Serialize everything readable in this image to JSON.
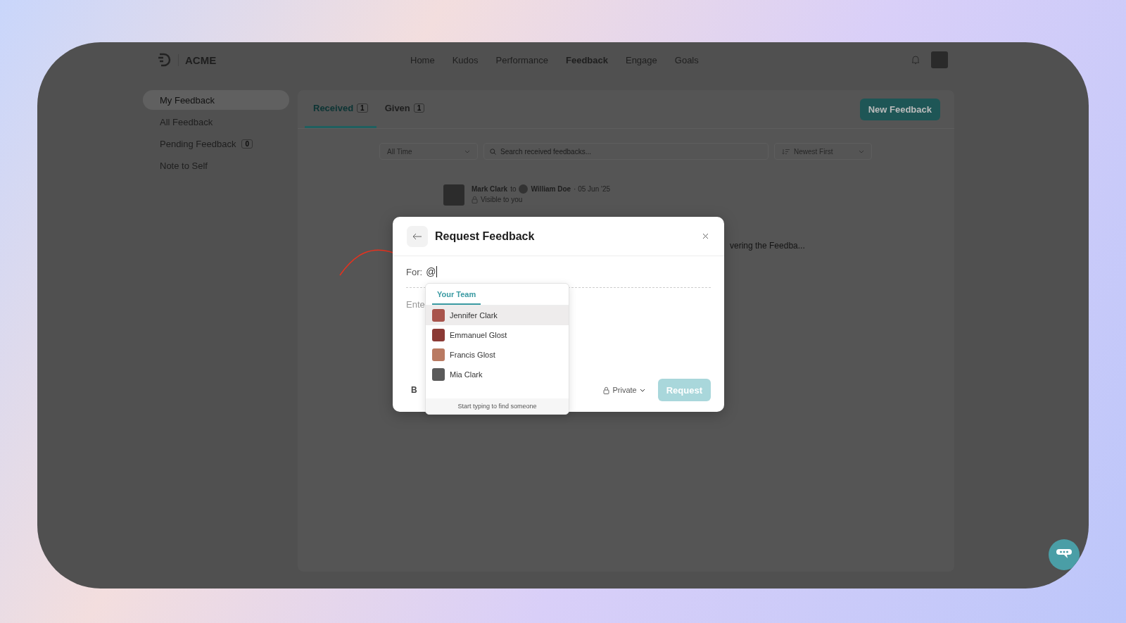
{
  "brand": {
    "name": "ACME"
  },
  "nav": [
    {
      "label": "Home",
      "selected": false
    },
    {
      "label": "Kudos",
      "selected": false
    },
    {
      "label": "Performance",
      "selected": false
    },
    {
      "label": "Feedback",
      "selected": true
    },
    {
      "label": "Engage",
      "selected": false
    },
    {
      "label": "Goals",
      "selected": false
    }
  ],
  "sidebar": {
    "items": [
      {
        "label": "My Feedback",
        "selected": true
      },
      {
        "label": "All Feedback",
        "selected": false
      },
      {
        "label": "Pending Feedback",
        "selected": false,
        "count": "0"
      },
      {
        "label": "Note to Self",
        "selected": false
      }
    ]
  },
  "tabs": [
    {
      "label": "Received",
      "count": "1",
      "selected": true
    },
    {
      "label": "Given",
      "count": "1",
      "selected": false
    }
  ],
  "new_button": "New Feedback",
  "filters": {
    "period": "All Time",
    "search": {
      "placeholder": "Search received feedbacks..."
    },
    "sort": "Newest First"
  },
  "feedback": {
    "author": "Mark Clark",
    "to": "to",
    "recipient": "William Doe",
    "date": "· 05 Jun '25",
    "visibility": "Visible to you",
    "excerpt": "vering the Feedba..."
  },
  "modal": {
    "title": "Request Feedback",
    "for_label": "For:",
    "for_value": "@",
    "body_placeholder": "Ente",
    "bold_button": "B",
    "privacy": "Private",
    "submit": {
      "label": "Request",
      "disabled": true
    }
  },
  "mention_menu": {
    "tabs": [
      {
        "label": "Your Team",
        "selected": true
      }
    ],
    "people": [
      {
        "name": "Jennifer Clark",
        "selected": true
      },
      {
        "name": "Emmanuel Glost",
        "selected": false
      },
      {
        "name": "Francis Glost",
        "selected": false
      },
      {
        "name": "Mia Clark",
        "selected": false
      }
    ],
    "hint": "Start typing to find someone"
  }
}
